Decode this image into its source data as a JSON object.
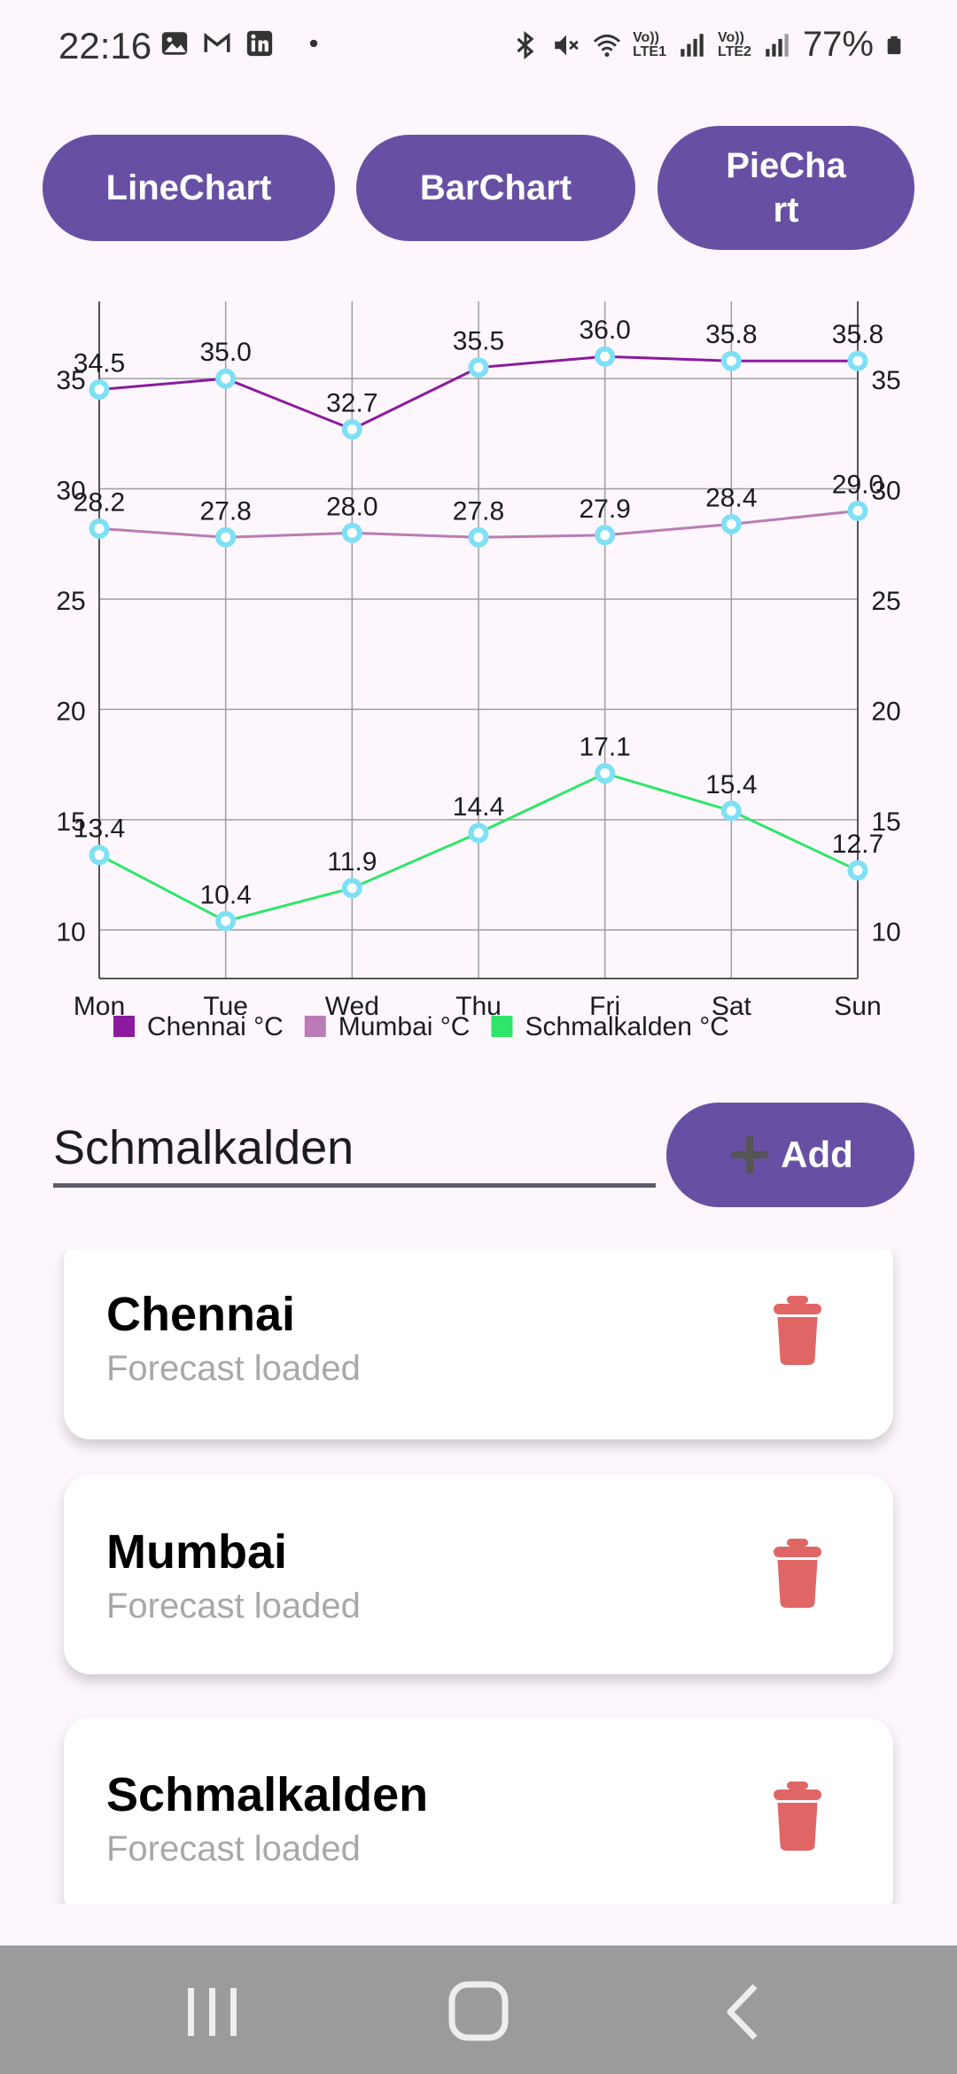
{
  "status_bar": {
    "time": "22:16",
    "battery": "77%",
    "icons": [
      "gallery-icon",
      "gmail-icon",
      "linkedin-icon",
      "dot-icon",
      "bluetooth-icon",
      "mute-icon",
      "wifi-icon",
      "signal-icon"
    ],
    "sim1_top": "Vo))",
    "sim1_bottom": "LTE1",
    "sim2_top": "Vo))",
    "sim2_bottom": "LTE2"
  },
  "chart_buttons": {
    "line": "LineChart",
    "bar": "BarChart",
    "pie_line1": "PieCha",
    "pie_line2": "rt"
  },
  "chart_data": {
    "type": "line",
    "categories": [
      "Mon",
      "Tue",
      "Wed",
      "Thu",
      "Fri",
      "Sat",
      "Sun"
    ],
    "series": [
      {
        "name": "Chennai °C",
        "color": "#8b1a9e",
        "values": [
          34.5,
          35.0,
          32.7,
          35.5,
          36.0,
          35.8,
          35.8
        ]
      },
      {
        "name": "Mumbai °C",
        "color": "#b97cb4",
        "values": [
          28.2,
          27.8,
          28.0,
          27.8,
          27.9,
          28.4,
          29.0
        ]
      },
      {
        "name": "Schmalkalden °C",
        "color": "#2ee66a",
        "values": [
          13.4,
          10.4,
          11.9,
          14.4,
          17.1,
          15.4,
          12.7
        ]
      }
    ],
    "value_labels": [
      [
        "34.5",
        "35.0",
        "32.7",
        "35.5",
        "36.0",
        "35.8",
        "35.8"
      ],
      [
        "28.2",
        "27.8",
        "28.0",
        "27.8",
        "27.9",
        "28.4",
        "29.0"
      ],
      [
        "13.4",
        "10.4",
        "11.9",
        "14.4",
        "17.1",
        "15.4",
        "12.7"
      ]
    ],
    "ylim": [
      7.8,
      38.5
    ],
    "yticks": [
      10,
      15,
      20,
      25,
      30,
      35
    ],
    "ytick_labels": [
      "10",
      "15",
      "20",
      "25",
      "30",
      "35"
    ],
    "grid": true,
    "y_axis_both_sides": true,
    "legend_position": "bottom-left",
    "marker_color": "#7fe0f5"
  },
  "add_row": {
    "input_value": "Schmalkalden",
    "add_label": "Add"
  },
  "cities": [
    {
      "name": "Chennai",
      "status": "Forecast loaded"
    },
    {
      "name": "Mumbai",
      "status": "Forecast loaded"
    },
    {
      "name": "Schmalkalden",
      "status": "Forecast loaded"
    }
  ],
  "colors": {
    "primary": "#6750a4",
    "background": "#fdf7fd",
    "delete": "#e06666"
  },
  "nav_bar": {
    "buttons": [
      "recents-icon",
      "home-icon",
      "back-icon"
    ]
  }
}
